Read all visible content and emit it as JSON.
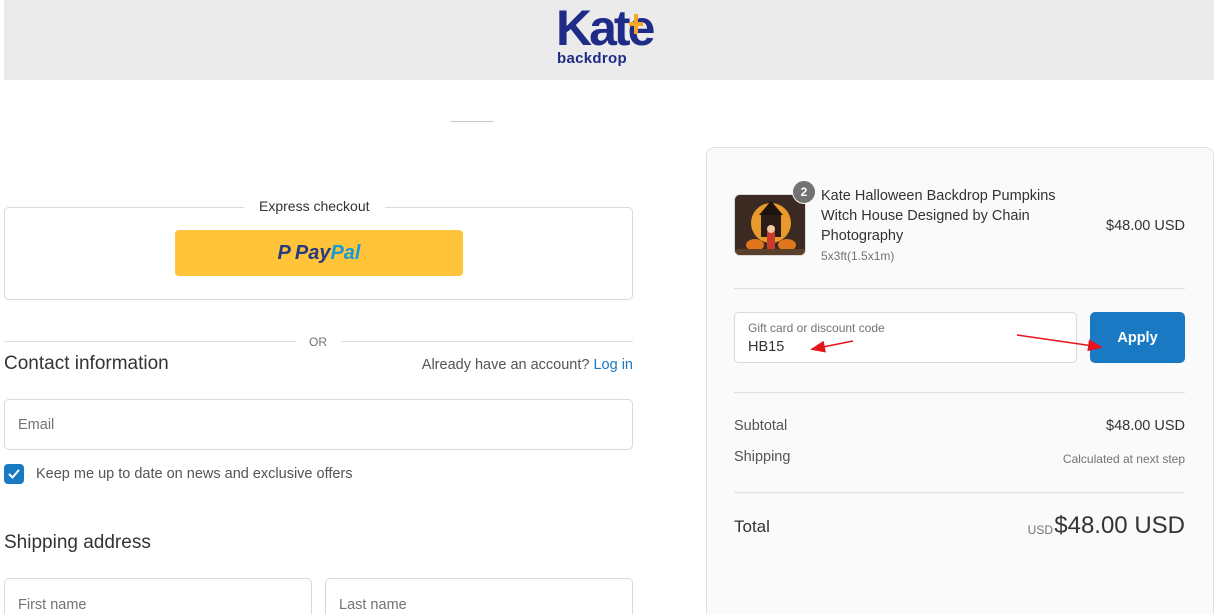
{
  "header": {
    "logo_main": "Kate",
    "logo_sub": "backdrop"
  },
  "express": {
    "label": "Express checkout",
    "paypal_p": "P",
    "paypal_a": "Pay",
    "paypal_b": "Pal"
  },
  "divider": {
    "or_text": "OR"
  },
  "contact": {
    "title": "Contact information",
    "account_prompt": "Already have an account?",
    "login_link": "Log in",
    "email_placeholder": "Email",
    "newsletter_label": "Keep me up to date on news and exclusive offers",
    "newsletter_checked": true
  },
  "shipping": {
    "title": "Shipping address",
    "first_name_placeholder": "First name",
    "last_name_placeholder": "Last name"
  },
  "summary": {
    "product": {
      "quantity": "2",
      "name": "Kate Halloween Backdrop Pumpkins Witch House Designed by Chain Photography",
      "variant": "5x3ft(1.5x1m)",
      "price": "$48.00 USD"
    },
    "discount": {
      "label": "Gift card or discount code",
      "value": "HB15",
      "apply_label": "Apply"
    },
    "subtotal_label": "Subtotal",
    "subtotal_value": "$48.00 USD",
    "shipping_label": "Shipping",
    "shipping_value": "Calculated at next step",
    "total_label": "Total",
    "total_currency": "USD",
    "total_amount": "$48.00 USD"
  },
  "colors": {
    "accent": "#1979c3",
    "paypal_yellow": "#ffc439",
    "brand_blue": "#1e2b88",
    "annotation_red": "#e8141b"
  },
  "icons": [
    "checkmark-icon",
    "arrow-annotation-icon"
  ]
}
